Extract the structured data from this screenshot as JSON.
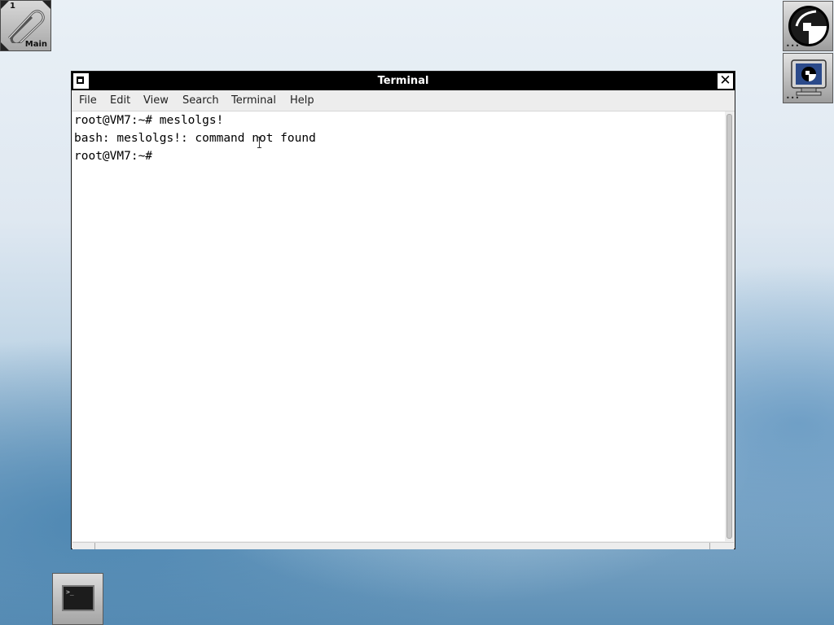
{
  "workspace": {
    "number": "1",
    "name": "Main"
  },
  "window": {
    "title": "Terminal"
  },
  "menu": [
    "File",
    "Edit",
    "View",
    "Search",
    "Terminal",
    "Help"
  ],
  "terminal": {
    "lines": [
      "root@VM7:~# meslolgs!",
      "bash: meslolgs!: command not found",
      "root@VM7:~#"
    ]
  },
  "icons": {
    "workspace": "paperclip-icon",
    "dock_top": "gnustep-logo-icon",
    "dock_second": "monitor-icon",
    "bottom": "terminal-icon"
  }
}
